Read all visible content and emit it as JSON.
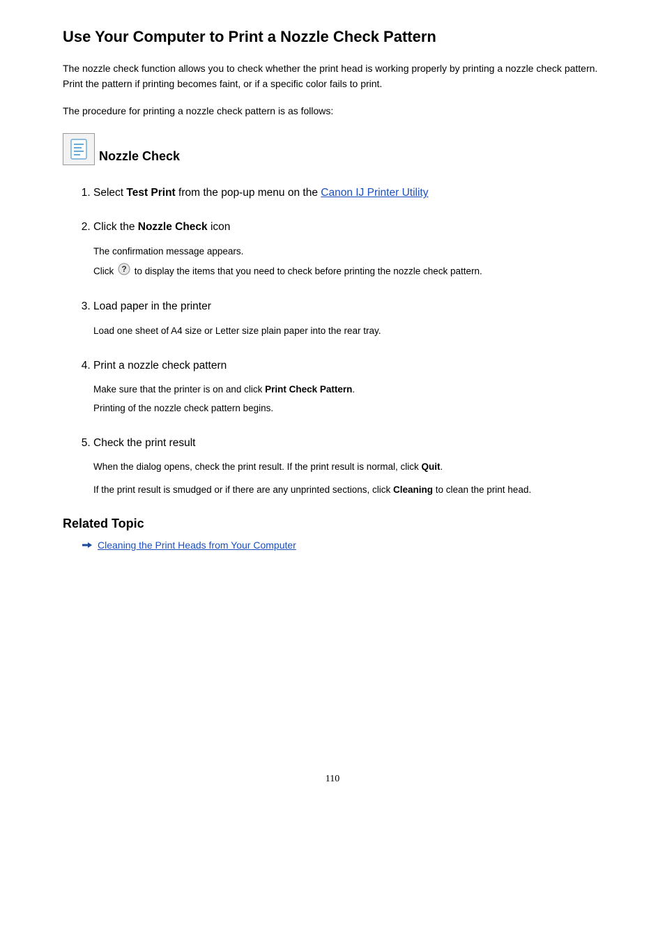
{
  "title": "Use Your Computer to Print a Nozzle Check Pattern",
  "intro1": "The nozzle check function allows you to check whether the print head is working properly by printing a nozzle check pattern. Print the pattern if printing becomes faint, or if a specific color fails to print.",
  "intro2": "The procedure for printing a nozzle check pattern is as follows:",
  "section": "Nozzle Check",
  "steps": {
    "s1": {
      "pre": "Select ",
      "bold": "Test Print",
      "mid": " from the pop-up menu on the ",
      "link": "Canon IJ Printer Utility"
    },
    "s2": {
      "title_pre": "Click the ",
      "title_bold": "Nozzle Check",
      "title_post": " icon",
      "b1": "The confirmation message appears.",
      "b2a": "Click ",
      "b2b": " to display the items that you need to check before printing the nozzle check pattern."
    },
    "s3": {
      "title": "Load paper in the printer",
      "b1": "Load one sheet of A4 size or Letter size plain paper into the rear tray."
    },
    "s4": {
      "title": "Print a nozzle check pattern",
      "b1a": "Make sure that the printer is on and click ",
      "b1bold": "Print Check Pattern",
      "b1b": ".",
      "b2": "Printing of the nozzle check pattern begins."
    },
    "s5": {
      "title": "Check the print result",
      "b1a": "When the dialog opens, check the print result. If the print result is normal, click ",
      "b1bold": "Quit",
      "b1b": ".",
      "b2a": "If the print result is smudged or if there are any unprinted sections, click ",
      "b2bold": "Cleaning",
      "b2b": " to clean the print head."
    }
  },
  "related": {
    "heading": "Related Topic",
    "link": "Cleaning the Print Heads from Your Computer"
  },
  "page_number": "110"
}
